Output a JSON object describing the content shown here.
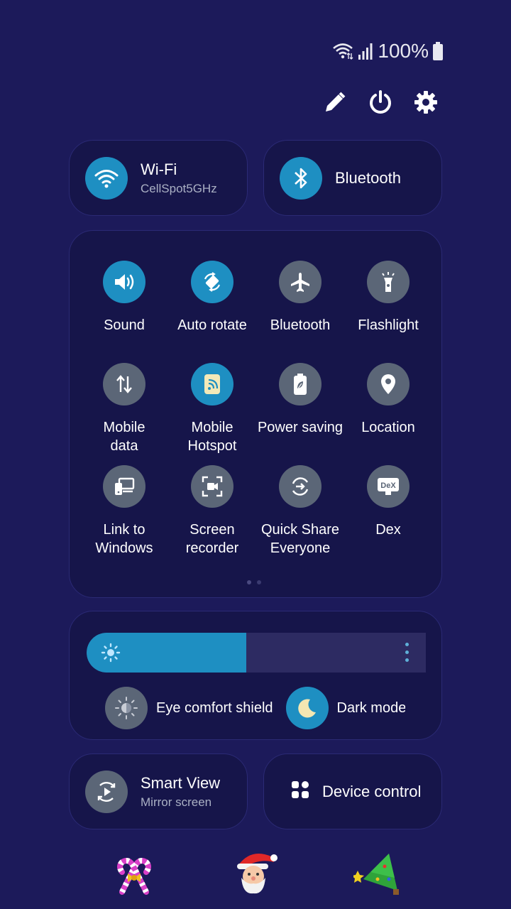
{
  "status": {
    "battery_text": "100%"
  },
  "top_actions": [
    "pencil-icon",
    "power-icon",
    "gear-icon"
  ],
  "wifi": {
    "title": "Wi-Fi",
    "network": "CellSpot5GHz"
  },
  "bluetooth_pill": {
    "title": "Bluetooth"
  },
  "tiles": [
    {
      "label": "Sound",
      "icon": "sound-icon",
      "on": true
    },
    {
      "label": "Auto rotate",
      "icon": "auto-rotate-icon",
      "on": true
    },
    {
      "label": "Bluetooth",
      "icon": "airplane-icon",
      "on": false
    },
    {
      "label": "Flashlight",
      "icon": "flashlight-icon",
      "on": false
    },
    {
      "label": "Mobile\ndata",
      "icon": "mobile-data-icon",
      "on": false
    },
    {
      "label": "Mobile\nHotspot",
      "icon": "hotspot-icon",
      "on": true
    },
    {
      "label": "Power saving",
      "icon": "power-saving-icon",
      "on": false
    },
    {
      "label": "Location",
      "icon": "location-icon",
      "on": false
    },
    {
      "label": "Link to\nWindows",
      "icon": "link-to-windows-icon",
      "on": false
    },
    {
      "label": "Screen\nrecorder",
      "icon": "screen-recorder-icon",
      "on": false
    },
    {
      "label": "Quick Share\nEveryone",
      "icon": "quick-share-icon",
      "on": false
    },
    {
      "label": "Dex",
      "icon": "dex-icon",
      "on": false
    }
  ],
  "brightness": {
    "level": 0.47
  },
  "eye_comfort": {
    "label": "Eye comfort shield"
  },
  "dark_mode": {
    "label": "Dark mode"
  },
  "smart_view": {
    "title": "Smart View",
    "subtitle": "Mirror screen"
  },
  "device_control": {
    "title": "Device control"
  },
  "colors": {
    "accent": "#1e8fc2",
    "tile_off": "#5b6677",
    "background": "#1c1a5a",
    "card": "#16154a"
  }
}
